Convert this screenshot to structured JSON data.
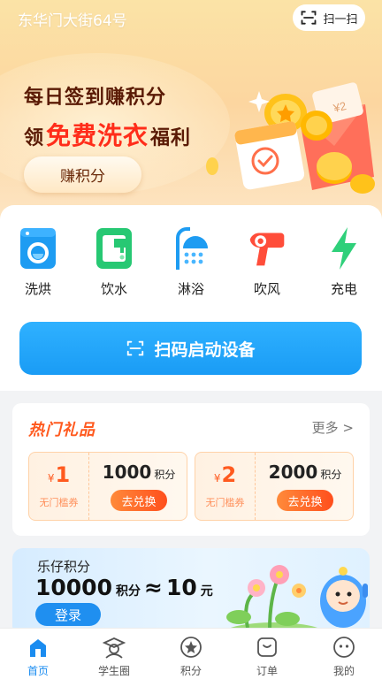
{
  "header": {
    "location": "东华门大街64号",
    "scan_label": "扫一扫"
  },
  "banner": {
    "line1": "每日签到赚积分",
    "line2_prefix": "领",
    "line2_highlight": "免费洗衣",
    "line2_suffix": "福利",
    "button": "赚积分",
    "art_badge": "¥2"
  },
  "services": {
    "items": [
      {
        "label": "洗烘",
        "icon": "washer-icon"
      },
      {
        "label": "饮水",
        "icon": "water-dispenser-icon"
      },
      {
        "label": "淋浴",
        "icon": "shower-icon"
      },
      {
        "label": "吹风",
        "icon": "hair-dryer-icon"
      },
      {
        "label": "充电",
        "icon": "lightning-icon"
      }
    ],
    "scan_button": "扫码启动设备"
  },
  "gifts": {
    "title": "热门礼品",
    "more": "更多 >",
    "coupons": [
      {
        "currency": "¥",
        "amount": "1",
        "condition": "无门槛券",
        "points": "1000",
        "points_unit": "积分",
        "button": "去兑换"
      },
      {
        "currency": "¥",
        "amount": "2",
        "condition": "无门槛券",
        "points": "2000",
        "points_unit": "积分",
        "button": "去兑换"
      }
    ]
  },
  "points_card": {
    "title": "乐仔积分",
    "points": "10000",
    "points_unit": "积分",
    "approx": "≈",
    "yuan": "10",
    "yuan_unit": "元",
    "login": "登录"
  },
  "tabbar": {
    "tabs": [
      {
        "label": "首页",
        "icon": "home-icon",
        "active": true
      },
      {
        "label": "学生圈",
        "icon": "student-icon",
        "active": false
      },
      {
        "label": "积分",
        "icon": "points-star-icon",
        "active": false
      },
      {
        "label": "订单",
        "icon": "order-icon",
        "active": false
      },
      {
        "label": "我的",
        "icon": "profile-icon",
        "active": false
      }
    ]
  },
  "colors": {
    "accent_blue": "#1a9cf5",
    "accent_orange": "#ff5a1f",
    "promo_red": "#ff2d1a",
    "service_green": "#2fd07a"
  }
}
